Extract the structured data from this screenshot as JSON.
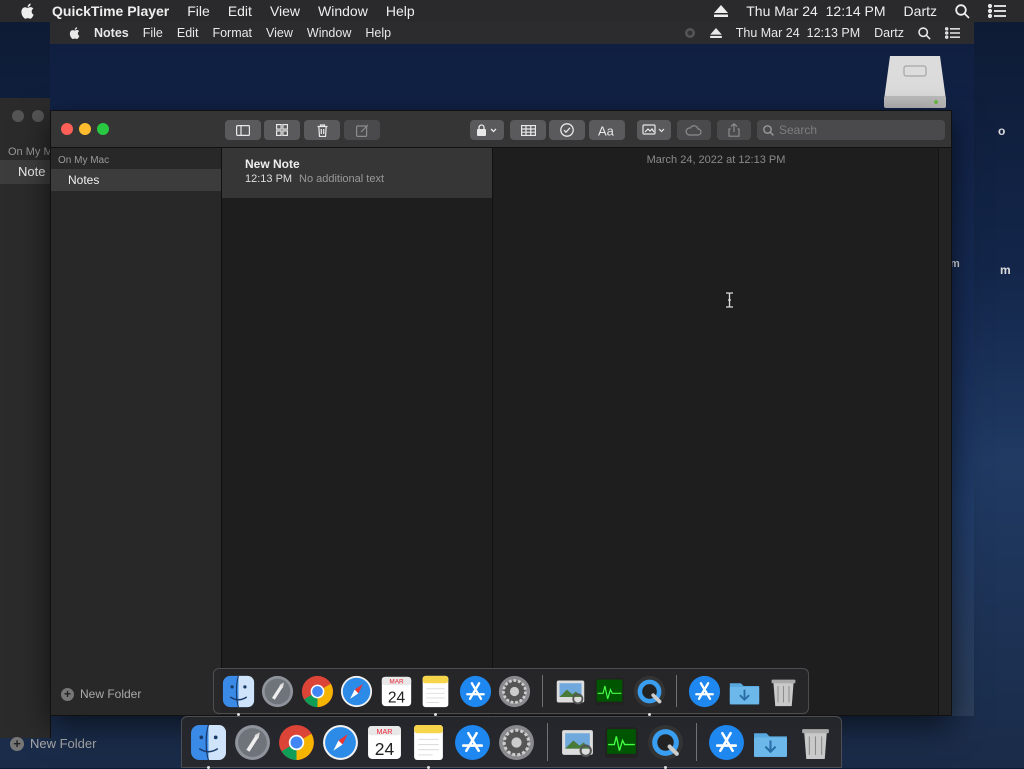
{
  "outer_menubar": {
    "app_name": "QuickTime Player",
    "menus": [
      "File",
      "Edit",
      "View",
      "Window",
      "Help"
    ],
    "datetime": "Thu Mar 24  12:14 PM",
    "user": "Dartz"
  },
  "inner_menubar": {
    "app_name": "Notes",
    "menus": [
      "File",
      "Edit",
      "Format",
      "View",
      "Window",
      "Help"
    ],
    "datetime": "Thu Mar 24  12:13 PM",
    "user": "Dartz"
  },
  "background_window": {
    "section": "On My M",
    "selected_folder": "Note",
    "new_folder": "New Folder"
  },
  "notes": {
    "sidebar_section": "On My Mac",
    "selected_folder": "Notes",
    "new_folder_label": "New Folder",
    "search_placeholder": "Search",
    "note_list": [
      {
        "title": "New Note",
        "time": "12:13 PM",
        "preview": "No additional text"
      }
    ],
    "editor_date": "March 24, 2022 at 12:13 PM"
  },
  "edge_labels": {
    "right_a": "m",
    "right_b": "m",
    "top_a": "o",
    "top_b": "o"
  },
  "calendar_icon": {
    "month": "MAR",
    "day": "24"
  },
  "dock_apps": [
    "Finder",
    "Launchpad",
    "Chrome",
    "Safari",
    "Calendar",
    "Notes",
    "App Store",
    "System Preferences",
    "Preview",
    "Activity Monitor",
    "QuickTime Player",
    "App Store",
    "Downloads",
    "Trash"
  ]
}
